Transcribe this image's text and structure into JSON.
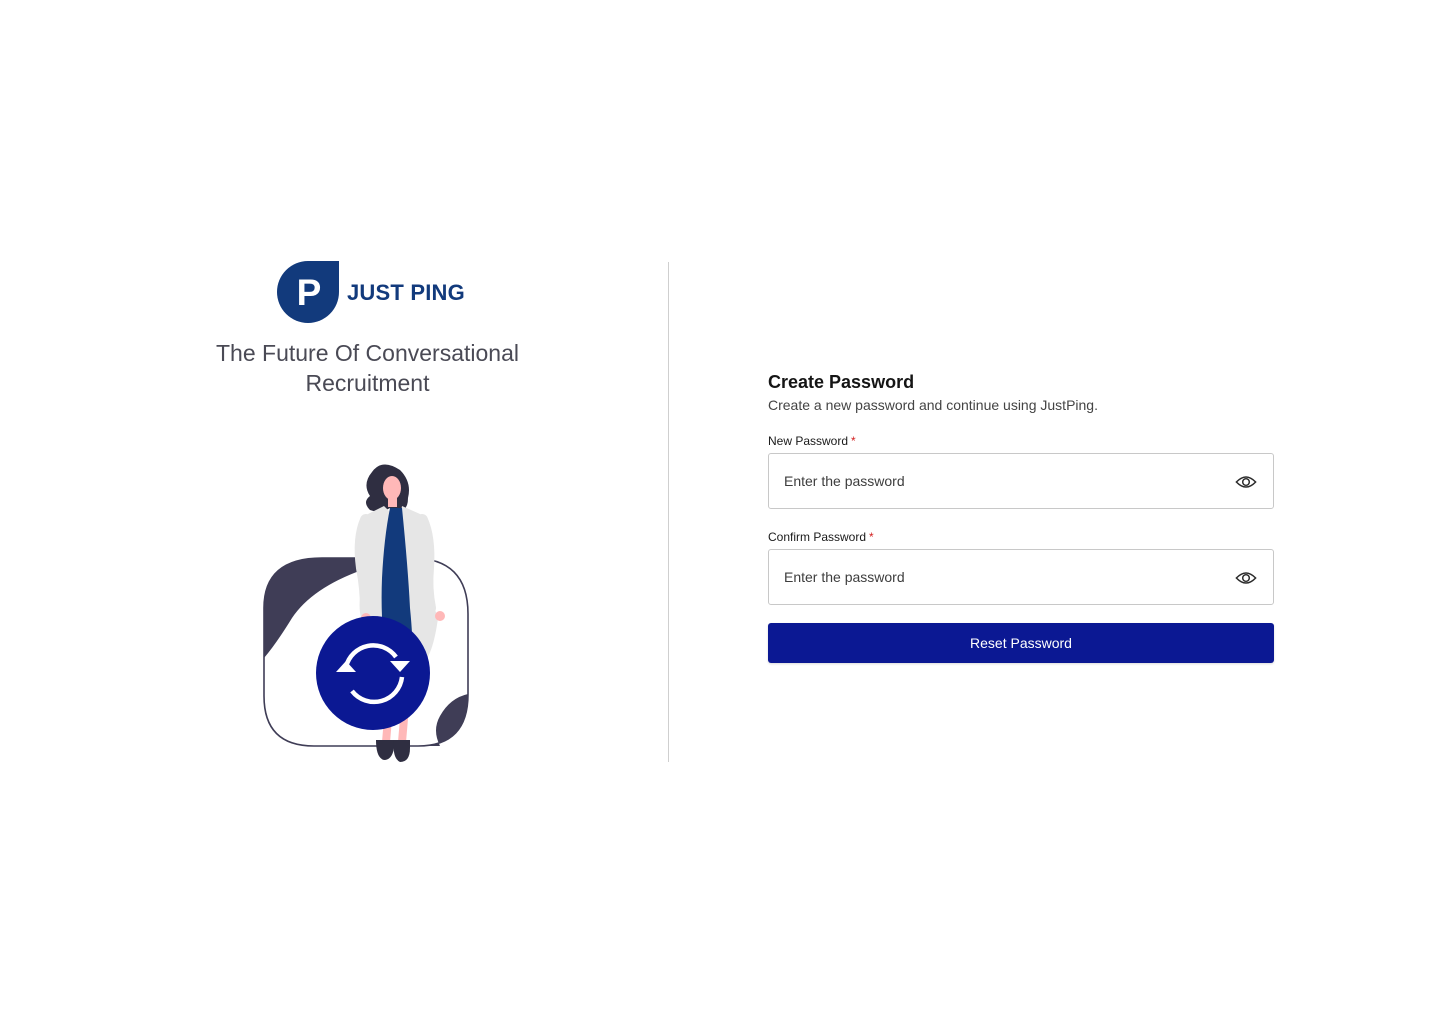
{
  "brand": {
    "name": "JUST PING",
    "logo_icon": "justping-logo-icon",
    "logo_letter": "P",
    "color": "#123a7c"
  },
  "tagline": {
    "line1": "The Future Of Conversational",
    "line2": "Recruitment"
  },
  "illustration": {
    "icon": "refresh-icon",
    "accent_color": "#0b1893"
  },
  "form": {
    "title": "Create Password",
    "subtitle": "Create a new password and continue using JustPing.",
    "new_password": {
      "label": "New Password",
      "required_mark": "*",
      "placeholder": "Enter the password",
      "value": "",
      "toggle_icon": "eye-icon"
    },
    "confirm_password": {
      "label": "Confirm Password",
      "required_mark": "*",
      "placeholder": "Enter the password",
      "value": "",
      "toggle_icon": "eye-icon"
    },
    "submit_label": "Reset Password",
    "submit_color": "#0b1893"
  }
}
